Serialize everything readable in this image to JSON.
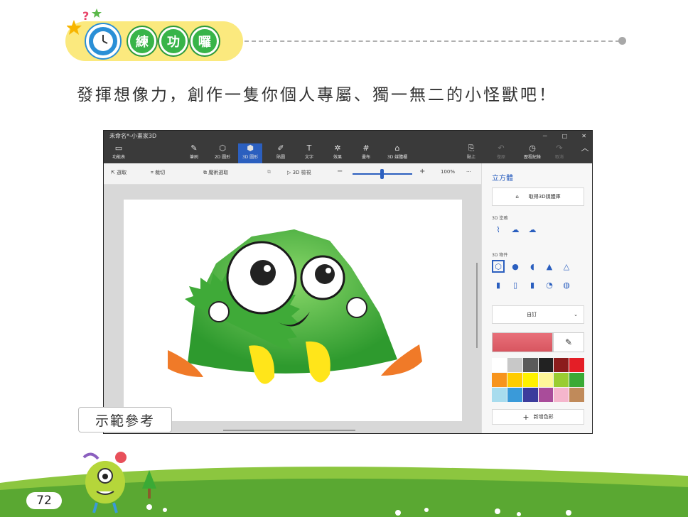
{
  "header": {
    "chips": [
      "練",
      "功",
      "囉"
    ]
  },
  "instruction": "發揮想像力，創作一隻你個人專屬、獨一無二的小怪獸吧！",
  "app": {
    "title": "未命名*-小畫家3D",
    "window_controls": [
      "－",
      "□",
      "✕"
    ],
    "ribbon": [
      {
        "icon": "▭",
        "label": "功能表"
      },
      {
        "icon": "✎",
        "label": "筆刷"
      },
      {
        "icon": "⬡",
        "label": "2D 圖形"
      },
      {
        "icon": "⬢",
        "label": "3D 圖形"
      },
      {
        "icon": "✐",
        "label": "貼圖"
      },
      {
        "icon": "T",
        "label": "文字"
      },
      {
        "icon": "✲",
        "label": "效果"
      },
      {
        "icon": "#",
        "label": "畫布"
      },
      {
        "icon": "⌂",
        "label": "3D 媒體櫃"
      },
      {
        "icon": "⎘",
        "label": "貼上"
      },
      {
        "icon": "↶",
        "label": "復原"
      },
      {
        "icon": "◷",
        "label": "歷程紀錄"
      },
      {
        "icon": "↷",
        "label": "取消"
      }
    ],
    "toolbar": {
      "select": "選取",
      "crop": "裁切",
      "magic_select": "魔術選取",
      "view3d": "3D 檢視",
      "zoom": "100%",
      "more": "···"
    },
    "panel": {
      "title": "立方體",
      "get_more": "取得3D媒體庫",
      "section_doodle": "3D 塗鴉",
      "section_objects": "3D 物件",
      "texture": "自訂",
      "add_color": "新增色彩"
    },
    "palette": [
      "#ffffff",
      "#c8c8c8",
      "#5a5a5a",
      "#222222",
      "#8c1c1c",
      "#e41e26",
      "#f7941d",
      "#ffcc00",
      "#fff200",
      "#fff799",
      "#9acd32",
      "#3aaa35",
      "#a8dcee",
      "#3a9ad9",
      "#3c3c9c",
      "#a94c9a",
      "#f5b6cd",
      "#c08a5a"
    ]
  },
  "caption": "示範參考",
  "page_number": "72"
}
